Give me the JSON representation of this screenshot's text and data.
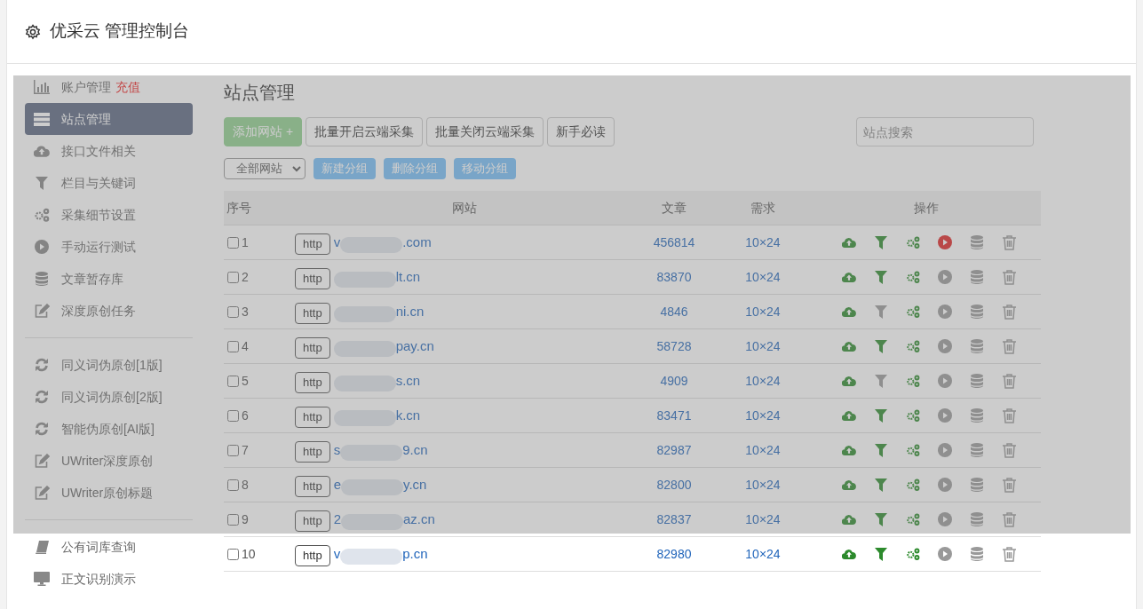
{
  "app_title": "优采云 管理控制台",
  "sidebar": {
    "groups": [
      {
        "items": [
          {
            "label": "账户管理",
            "badge": "充值",
            "selected": false
          },
          {
            "label": "站点管理",
            "selected": true
          },
          {
            "label": "接口文件相关",
            "selected": false
          },
          {
            "label": "栏目与关键词",
            "selected": false
          },
          {
            "label": "采集细节设置",
            "selected": false
          },
          {
            "label": "手动运行测试",
            "selected": false
          },
          {
            "label": "文章暂存库",
            "selected": false
          },
          {
            "label": "深度原创任务",
            "selected": false
          }
        ]
      },
      {
        "items": [
          {
            "label": "同义词伪原创[1版]",
            "selected": false
          },
          {
            "label": "同义词伪原创[2版]",
            "selected": false
          },
          {
            "label": "智能伪原创[AI版]",
            "selected": false
          },
          {
            "label": "UWriter深度原创",
            "selected": false
          },
          {
            "label": "UWriter原创标题",
            "selected": false
          }
        ]
      },
      {
        "items": [
          {
            "label": "公有词库查询",
            "selected": false
          },
          {
            "label": "正文识别演示",
            "selected": false
          }
        ]
      }
    ]
  },
  "main": {
    "title": "站点管理",
    "toolbar": [
      {
        "label": "添加网站 +",
        "kind": "primary"
      },
      {
        "label": "批量开启云端采集",
        "kind": "default"
      },
      {
        "label": "批量关闭云端采集",
        "kind": "default"
      },
      {
        "label": "新手必读",
        "kind": "default"
      }
    ],
    "search": {
      "placeholder": "站点搜索"
    },
    "group_select": {
      "value": "全部网站"
    },
    "group_buttons": [
      "新建分组",
      "删除分组",
      "移动分组"
    ],
    "table": {
      "columns": [
        "序号",
        "网站",
        "文章",
        "需求",
        "操作"
      ],
      "rows": [
        {
          "no": "1",
          "scheme": "http",
          "prefix": "v",
          "suffix": ".com",
          "articles": "456814",
          "demand": "10×24",
          "filter_on": true,
          "running": true,
          "checked": false
        },
        {
          "no": "2",
          "scheme": "http",
          "suffix": "lt.cn",
          "articles": "83870",
          "demand": "10×24",
          "filter_on": true,
          "running": false,
          "checked": false
        },
        {
          "no": "3",
          "scheme": "http",
          "suffix": "ni.cn",
          "articles": "4846",
          "demand": "10×24",
          "filter_on": false,
          "running": false,
          "checked": false
        },
        {
          "no": "4",
          "scheme": "http",
          "suffix": "pay.cn",
          "articles": "58728",
          "demand": "10×24",
          "filter_on": true,
          "running": false,
          "checked": false
        },
        {
          "no": "5",
          "scheme": "http",
          "suffix": "s.cn",
          "articles": "4909",
          "demand": "10×24",
          "filter_on": false,
          "running": false,
          "checked": false
        },
        {
          "no": "6",
          "scheme": "http",
          "suffix": "k.cn",
          "articles": "83471",
          "demand": "10×24",
          "filter_on": true,
          "running": false,
          "checked": false
        },
        {
          "no": "7",
          "scheme": "http",
          "prefix": "s",
          "suffix": "9.cn",
          "articles": "82987",
          "demand": "10×24",
          "filter_on": true,
          "running": false,
          "checked": false
        },
        {
          "no": "8",
          "scheme": "http",
          "prefix": "e",
          "suffix": "y.cn",
          "articles": "82800",
          "demand": "10×24",
          "filter_on": true,
          "running": false,
          "checked": false
        },
        {
          "no": "9",
          "scheme": "http",
          "prefix": "2",
          "suffix": "az.cn",
          "articles": "82837",
          "demand": "10×24",
          "filter_on": true,
          "running": false,
          "checked": false
        },
        {
          "no": "10",
          "scheme": "http",
          "prefix": "v",
          "suffix": "p.cn",
          "articles": "82980",
          "demand": "10×24",
          "filter_on": true,
          "running": false,
          "checked": false
        }
      ]
    }
  }
}
